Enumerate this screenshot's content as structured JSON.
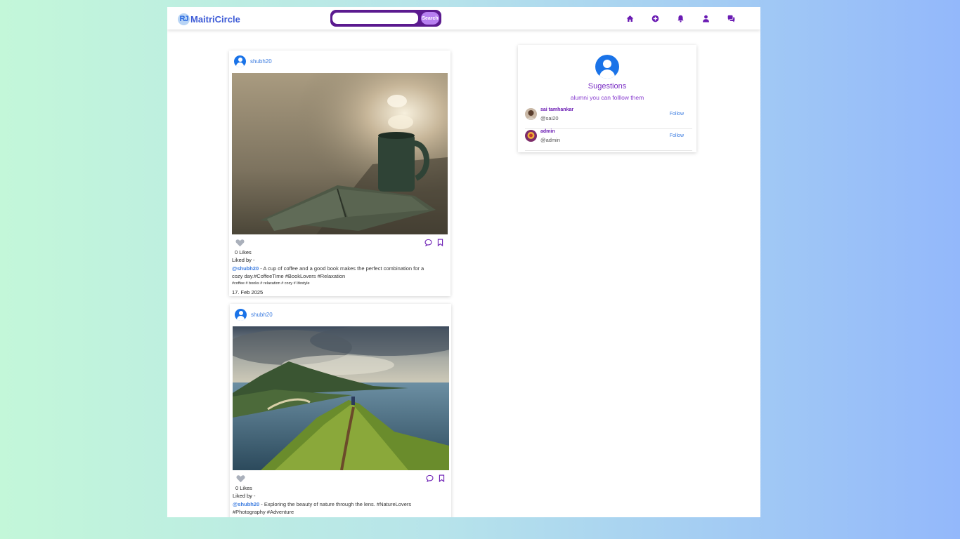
{
  "app": {
    "logo_mark": "RJ",
    "logo_text": "MaitriCircle",
    "search_placeholder": "",
    "search_button": "Search",
    "nav_icons": [
      "home-icon",
      "add-circle-icon",
      "bell-icon",
      "user-icon",
      "chat-icon"
    ]
  },
  "posts": [
    {
      "username": "shubh20",
      "likes": "0 Likes",
      "liked_by": "Liked by -",
      "handle": "@shubh20",
      "caption": " - A cup of coffee and a good book makes the perfect combination for a cozy day.#CoffeeTime #BookLovers #Relaxation",
      "tags": "#coffee # books # relaxation # cozy # lifestyle",
      "date": "17. Feb 2025",
      "image": "coffee-mug-and-book-photo"
    },
    {
      "username": "shubh20",
      "likes": "0 Likes",
      "liked_by": "Liked by -",
      "handle": "@shubh20",
      "caption": " - Exploring the beauty of nature through the lens. #NatureLovers #Photography #Adventure",
      "image": "mountain-ridge-coast-photo"
    }
  ],
  "suggestions": {
    "title": "Sugestions",
    "subtitle": "alumni you can folllow them",
    "users": [
      {
        "name": "sai tamhankar",
        "handle": "@sai20",
        "follow": "Follow"
      },
      {
        "name": "admin",
        "handle": "@admin",
        "follow": "Follow"
      }
    ]
  },
  "colors": {
    "accent_purple": "#6a1bb3",
    "link_blue": "#3a7be0",
    "avatar_blue": "#1a73e8"
  }
}
